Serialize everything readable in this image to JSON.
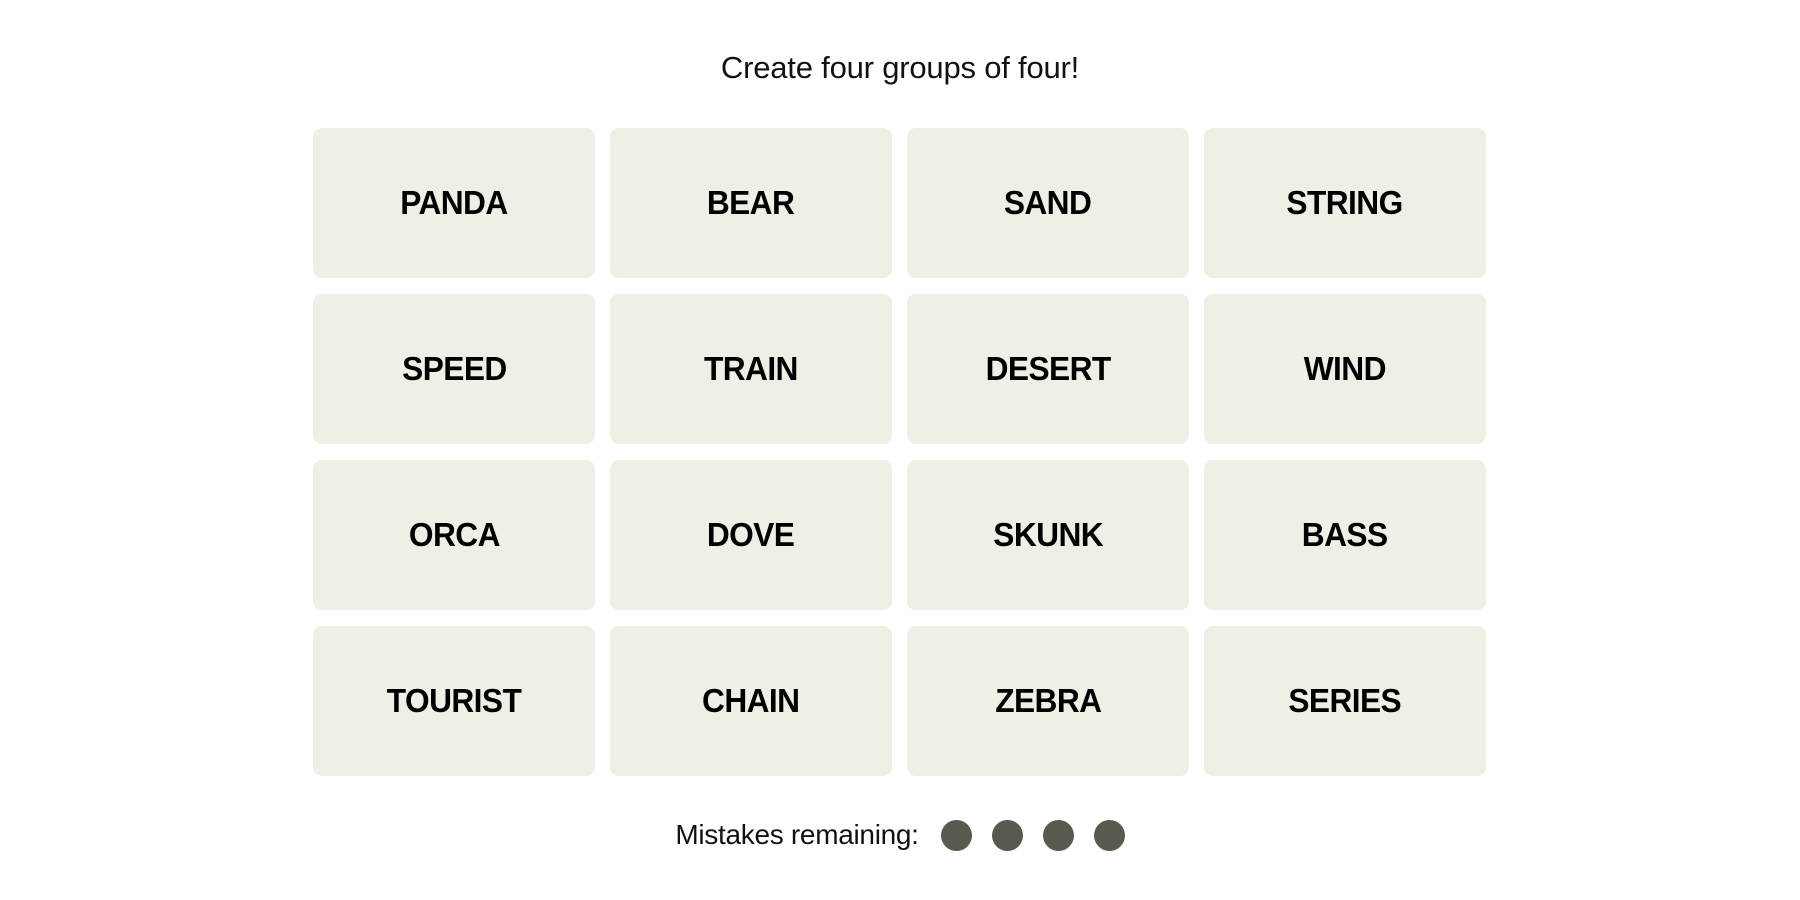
{
  "game": {
    "title": "Create four groups of four!",
    "tiles": [
      [
        "PANDA",
        "BEAR",
        "SAND",
        "STRING"
      ],
      [
        "SPEED",
        "TRAIN",
        "DESERT",
        "WIND"
      ],
      [
        "ORCA",
        "DOVE",
        "SKUNK",
        "BASS"
      ],
      [
        "TOURIST",
        "CHAIN",
        "ZEBRA",
        "SERIES"
      ]
    ],
    "mistakes_label": "Mistakes remaining:",
    "mistakes_remaining": 4,
    "colors": {
      "tile_background": "#efefe6",
      "dot": "#5a594e",
      "text": "#121212"
    }
  }
}
